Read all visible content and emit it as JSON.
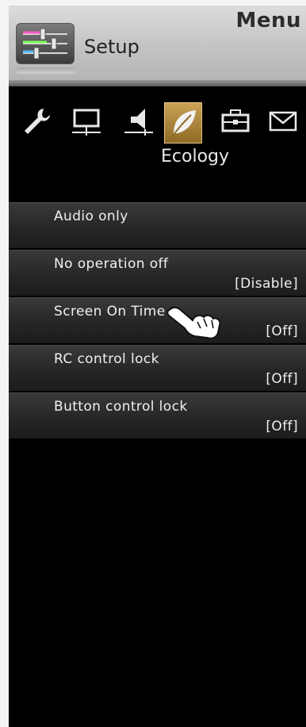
{
  "header": {
    "menu_title": "Menu",
    "section_label": "Setup",
    "section_icon": "sliders-icon"
  },
  "categories": {
    "active_label": "Ecology",
    "items": [
      {
        "icon": "wrench-icon",
        "active": false
      },
      {
        "icon": "monitor-icon",
        "active": false
      },
      {
        "icon": "speaker-icon",
        "active": false
      },
      {
        "icon": "leaf-icon",
        "active": true
      },
      {
        "icon": "toolbox-icon",
        "active": false
      },
      {
        "icon": "envelope-icon",
        "active": false
      }
    ]
  },
  "settings": [
    {
      "label": "Audio only",
      "value": ""
    },
    {
      "label": "No operation off",
      "value": "[Disable]"
    },
    {
      "label": "Screen On Time",
      "value": "[Off]"
    },
    {
      "label": "RC control lock",
      "value": "[Off]"
    },
    {
      "label": "Button control lock",
      "value": "[Off]"
    }
  ],
  "colors": {
    "panel_bg": "#000000",
    "active_tab": "#b48a3c",
    "text": "#f0f0f0"
  }
}
